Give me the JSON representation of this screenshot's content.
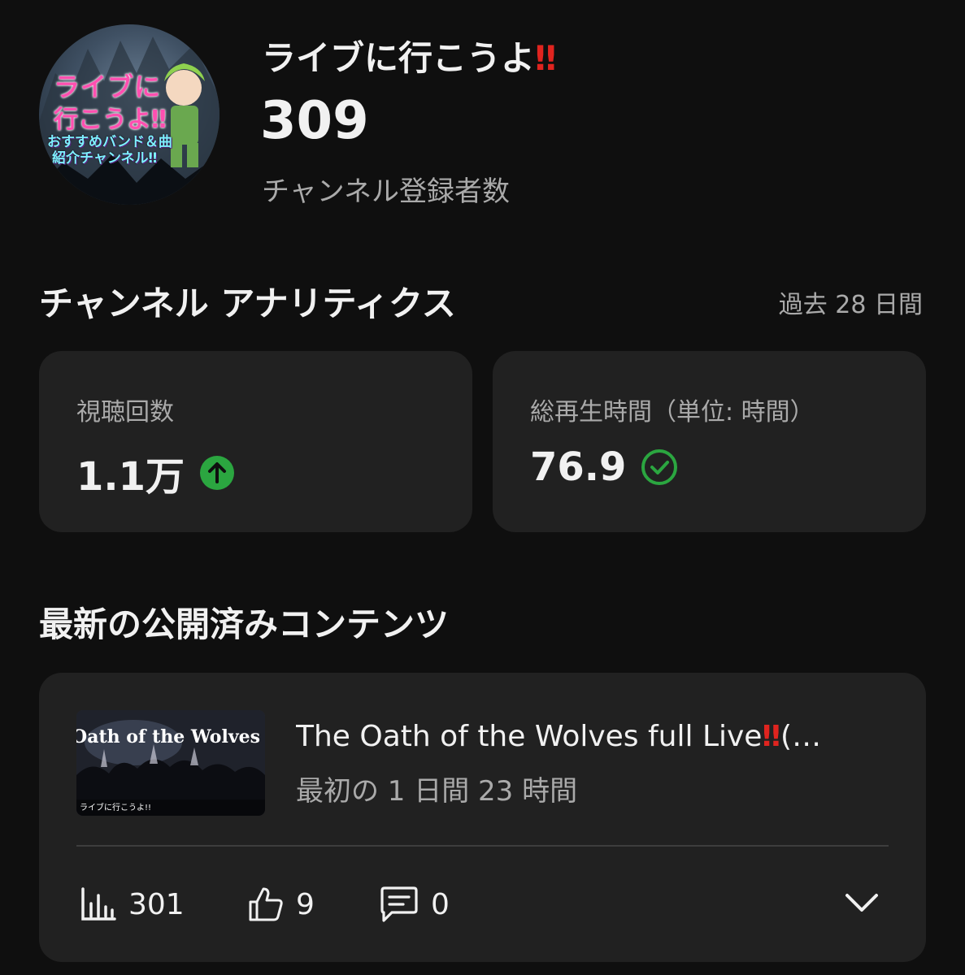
{
  "channel": {
    "avatar": {
      "line1": "ライブに",
      "line2": "行こうよ‼",
      "line3": "おすすめバンド＆曲",
      "line4": "紹介チャンネル‼"
    },
    "name": "ライブに行こうよ",
    "name_emoji": "‼",
    "subscriber_count": "309",
    "subscriber_label": "チャンネル登録者数"
  },
  "analytics": {
    "title": "チャンネル アナリティクス",
    "period": "過去 28 日間",
    "metrics": [
      {
        "label": "視聴回数",
        "value": "1.1万",
        "status_icon": "arrow-up-circle-icon"
      },
      {
        "label": "総再生時間（単位: 時間）",
        "value": "76.9",
        "status_icon": "check-circle-icon"
      }
    ]
  },
  "latest": {
    "title": "最新の公開済みコンテンツ",
    "video": {
      "thumbnail_title": "The Oath of the Wolves",
      "thumbnail_footer": "ライブに行こうよ!!",
      "title_text": "The Oath of the Wolves full Live",
      "title_emoji": "‼",
      "title_tail": "(…",
      "subtitle": "最初の 1 日間 23 時間",
      "views": "301",
      "likes": "9",
      "comments": "0"
    }
  },
  "colors": {
    "background": "#0f0f0f",
    "card": "#212121",
    "accent_green": "#2ba640",
    "emoji_red": "#e0241f",
    "muted_text": "#aaaaaa"
  }
}
